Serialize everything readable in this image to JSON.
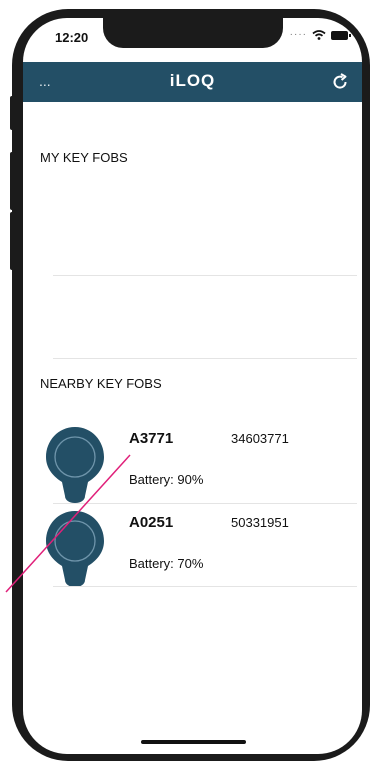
{
  "status_bar": {
    "time": "12:20",
    "icons": [
      "cellular-dots-icon",
      "wifi-icon",
      "battery-icon"
    ]
  },
  "navbar": {
    "menu_label": "...",
    "title": "iLOQ",
    "refresh_icon": "refresh-icon",
    "background": "#234f66"
  },
  "sections": {
    "my_key_fobs": {
      "title": "MY KEY FOBS"
    },
    "nearby_key_fobs": {
      "title": "NEARBY KEY FOBS"
    }
  },
  "nearby_fobs": [
    {
      "name": "A3771",
      "serial": "34603771",
      "battery": "Battery: 90%"
    },
    {
      "name": "A0251",
      "serial": "50331951",
      "battery": "Battery: 70%"
    }
  ],
  "colors": {
    "fob": "#234f66",
    "annotation_line": "#e0207a"
  }
}
